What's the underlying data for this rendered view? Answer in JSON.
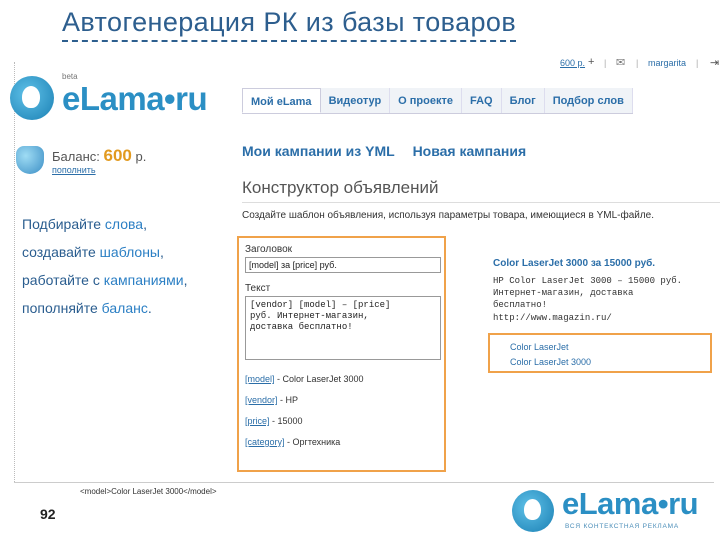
{
  "slide": {
    "title": "Автогенерация РК из базы товаров",
    "page_number": "92"
  },
  "logo": {
    "beta": "beta",
    "text": "eLama•ru"
  },
  "balance": {
    "label": "Баланс:",
    "amount": "600",
    "currency": "р.",
    "topup": "пополнить"
  },
  "promo": {
    "line1": {
      "text": "Подбирайте",
      "kw": "слова",
      "tail": ","
    },
    "line2": {
      "text": "создавайте",
      "kw": "шаблоны",
      "tail": ","
    },
    "line3": {
      "text": "работайте с",
      "kw": "кампаниями",
      "tail": ","
    },
    "line4": {
      "text": "пополняйте",
      "kw": "баланс",
      "tail": "."
    }
  },
  "top_bar": {
    "balance": "600 р.",
    "plus": "+",
    "mail": "✉",
    "user": "margarita",
    "exit": "⇥",
    "sep": "|"
  },
  "nav": {
    "tabs": [
      "Мой eLama",
      "Видеотур",
      "О проекте",
      "FAQ",
      "Блог",
      "Подбор слов"
    ]
  },
  "campaigns": {
    "mine": "Мои кампании из YML",
    "new": "Новая кампания"
  },
  "constructor": {
    "title": "Конструктор объявлений",
    "instruction": "Создайте шаблон объявления, используя параметры товара, имеющиеся в YML-файле."
  },
  "editor": {
    "title_label": "Заголовок",
    "title_value": "[model] за [price] руб.",
    "text_label": "Текст",
    "text_value": "[vendor] [model] – [price]\nруб. Интернет-магазин,\nдоставка бесплатно!",
    "params": [
      {
        "key": "[model]",
        "value": " - Color LaserJet 3000"
      },
      {
        "key": "[vendor]",
        "value": " - HP"
      },
      {
        "key": "[price]",
        "value": " - 15000"
      },
      {
        "key": "[category]",
        "value": " - Оргтехника"
      }
    ]
  },
  "preview": {
    "title": "Color LaserJet 3000 за 15000 руб.",
    "body": "HP Color LaserJet 3000 – 15000 руб.\nИнтернет-магазин, доставка\nбесплатно!",
    "url": "http://www.magazin.ru/",
    "results": [
      "Color LaserJet",
      "Color LaserJet 3000"
    ]
  },
  "xml_sample": "<model>Color LaserJet 3000</model>",
  "footer": {
    "logo_text": "eLama•ru",
    "tagline": "ВСЯ КОНТЕКСТНАЯ РЕКЛАМА"
  },
  "colors": {
    "accent": "#2b6ea8",
    "highlight_border": "#f0a24a",
    "balance": "#e29a1f"
  }
}
